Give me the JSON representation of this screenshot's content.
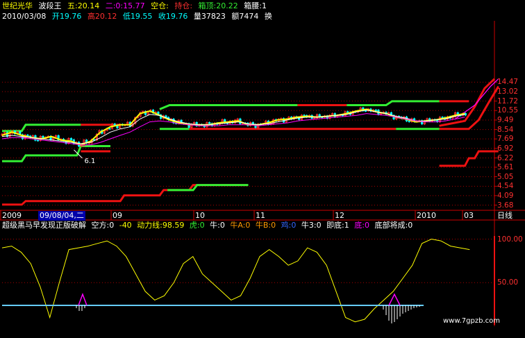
{
  "header": {
    "stock_name": "世纪光华",
    "indicator_name": "波段王",
    "wu_label": "五:20.14",
    "er_label": "二:0:15.77",
    "kongcang_label": "空仓:",
    "chicang_label": "持仓:",
    "xiangding_label": "箱顶:20.22",
    "xiangyao_label": "箱腰:1",
    "date": "2010/03/08",
    "open": "开19.76",
    "high": "高20.12",
    "low": "低19.55",
    "close": "收19.76",
    "volume": "量37823",
    "amount": "额7474",
    "more": "换"
  },
  "indicator_header": {
    "name": "超级黑马早发现正版破解",
    "kongfang": "空方:0",
    "minus40": "-40",
    "dongli": "动力线:98.59",
    "hu": "虎:0",
    "niu": "牛:0",
    "niuA": "牛A:0",
    "niuB": "牛B:0",
    "ji": "鸡:0",
    "niu3": "牛3:0",
    "jidi": "即底:1",
    "di": "底:0",
    "dibu": "底部将成:0"
  },
  "x_axis": {
    "labels": [
      "2009",
      "09",
      "10",
      "11",
      "12",
      "2010",
      "03"
    ],
    "selected_date": "09/08/04,二",
    "period": "日线"
  },
  "watermark": "www.7gpzb.com",
  "colors": {
    "up": "#ff3030",
    "down": "#00ffff",
    "green_line": "#33ee33",
    "red_line": "#ee1111",
    "yellow": "#ffff00",
    "magenta": "#ff00ff",
    "white": "#ffffff",
    "grid": "#aa0000",
    "axis": "#cc0000"
  },
  "chart_data": [
    {
      "type": "line",
      "title": "",
      "y_ticks": [
        14.47,
        13.02,
        11.72,
        10.55,
        9.49,
        8.54,
        7.69,
        6.92,
        6.22,
        5.61,
        5.05,
        4.54,
        4.09,
        3.68
      ],
      "annotation": "6.1",
      "x_tick_labels": [
        "2009",
        "09",
        "10",
        "11",
        "12",
        "2010",
        "03"
      ],
      "series": [
        {
          "x": [
            0,
            5,
            10,
            15,
            20,
            25,
            30,
            35,
            40,
            45,
            50,
            55,
            60,
            65,
            70,
            75,
            80,
            85,
            90,
            95,
            100,
            105,
            110,
            115,
            120,
            125,
            130,
            135,
            140,
            145,
            150,
            155,
            160,
            165,
            170,
            175,
            180,
            185,
            190,
            195,
            200,
            205,
            210,
            215,
            220,
            225,
            230,
            235
          ],
          "values": [
            8.0,
            8.3,
            8.0,
            7.8,
            7.7,
            7.9,
            7.6,
            7.5,
            7.2,
            7.5,
            8.3,
            8.8,
            9.0,
            9.0,
            10.2,
            10.5,
            10.0,
            9.5,
            9.2,
            9.0,
            9.0,
            9.0,
            9.2,
            9.3,
            9.4,
            9.0,
            9.0,
            9.2,
            9.5,
            9.6,
            9.8,
            9.9,
            9.8,
            9.9,
            10.0,
            10.2,
            10.5,
            10.7,
            10.4,
            10.2,
            9.8,
            9.6,
            9.3,
            9.4,
            9.5,
            9.7,
            10.0,
            10.2
          ]
        },
        {
          "x": [
            0,
            5,
            10,
            15,
            20,
            25,
            30,
            35,
            40,
            45,
            50,
            55,
            60,
            65,
            70,
            75,
            80,
            85,
            90,
            95,
            100,
            105,
            110,
            115,
            120,
            125,
            130,
            135,
            140,
            145,
            150,
            155,
            160,
            165,
            170,
            175,
            180,
            185,
            190,
            195,
            200,
            205,
            210,
            215,
            220,
            225,
            230,
            235
          ],
          "values": [
            7.9,
            8.0,
            7.9,
            7.8,
            7.7,
            7.6,
            7.5,
            7.4,
            7.3,
            7.4,
            7.8,
            8.3,
            8.6,
            8.8,
            9.6,
            10.1,
            10.0,
            9.6,
            9.3,
            9.1,
            9.0,
            9.0,
            9.1,
            9.2,
            9.3,
            9.1,
            9.0,
            9.1,
            9.3,
            9.5,
            9.7,
            9.8,
            9.8,
            9.9,
            10.0,
            10.1,
            10.4,
            10.6,
            10.4,
            10.2,
            9.9,
            9.7,
            9.4,
            9.4,
            9.5,
            9.6,
            9.9,
            10.1
          ]
        },
        {
          "x": [
            0,
            5,
            10,
            15,
            20,
            25,
            30,
            35,
            40,
            45,
            50,
            55,
            60,
            65,
            70,
            75,
            80,
            85,
            90,
            95,
            100,
            105,
            110,
            115,
            120,
            125,
            130,
            135,
            140,
            145,
            150,
            155,
            160,
            165,
            170,
            175,
            180,
            185,
            190,
            195,
            200,
            205,
            210,
            215,
            220,
            225,
            230,
            235
          ],
          "values": [
            7.7,
            7.8,
            7.8,
            7.7,
            7.6,
            7.5,
            7.4,
            7.3,
            7.2,
            7.2,
            7.4,
            7.7,
            8.0,
            8.3,
            8.8,
            9.3,
            9.4,
            9.3,
            9.1,
            9.0,
            8.9,
            8.9,
            8.9,
            9.0,
            9.0,
            9.0,
            8.9,
            9.0,
            9.1,
            9.2,
            9.4,
            9.5,
            9.6,
            9.7,
            9.8,
            9.9,
            10.0,
            10.2,
            10.1,
            10.0,
            9.8,
            9.6,
            9.4,
            9.3,
            9.3,
            9.4,
            9.6,
            9.8
          ]
        }
      ]
    },
    {
      "type": "line",
      "title": "",
      "y_ticks": [
        100.0,
        50.0
      ],
      "ylim": [
        0,
        110
      ],
      "series": [
        {
          "x": [
            0,
            5,
            10,
            15,
            20,
            25,
            30,
            35,
            40,
            45,
            50,
            55,
            60,
            65,
            70,
            75,
            80,
            85,
            90,
            95,
            100,
            105,
            110,
            115,
            120,
            125,
            130,
            135,
            140,
            145,
            150,
            155,
            160,
            165,
            170,
            175,
            180,
            185,
            190,
            195,
            200,
            205,
            210,
            215,
            220,
            225,
            230,
            235,
            240,
            245
          ],
          "values": [
            90,
            92,
            85,
            72,
            45,
            10,
            50,
            88,
            90,
            92,
            95,
            98,
            92,
            80,
            60,
            40,
            30,
            35,
            50,
            72,
            80,
            60,
            50,
            40,
            30,
            35,
            55,
            80,
            88,
            80,
            70,
            75,
            90,
            85,
            70,
            40,
            10,
            5,
            8,
            20,
            30,
            40,
            55,
            70,
            95,
            100,
            98,
            92,
            90,
            88
          ]
        }
      ]
    }
  ]
}
